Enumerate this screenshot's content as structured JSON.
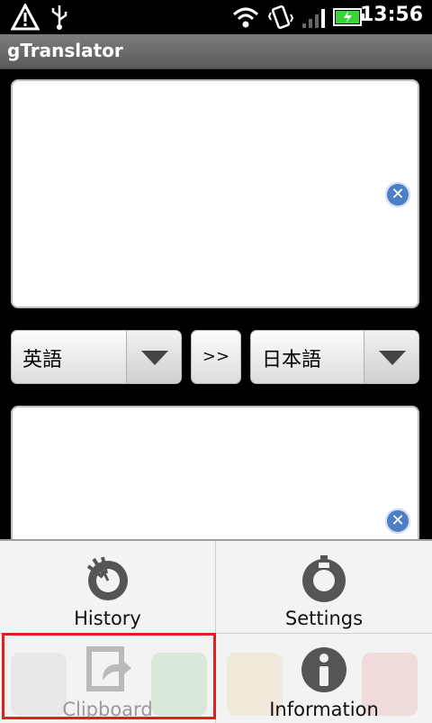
{
  "status_bar": {
    "time": "13:56",
    "icons": [
      "warning-icon",
      "usb-icon",
      "wifi-icon",
      "vibrate-icon",
      "signal-icon",
      "battery-charging-icon"
    ]
  },
  "app": {
    "title": "gTranslator"
  },
  "source_box": {
    "value": ""
  },
  "target_box": {
    "value": ""
  },
  "languages": {
    "from": "英語",
    "swap_label": ">>",
    "to": "日本語"
  },
  "menu": {
    "items": [
      {
        "label": "History",
        "icon": "history-icon"
      },
      {
        "label": "Settings",
        "icon": "settings-icon"
      },
      {
        "label": "Clipboard",
        "icon": "clipboard-icon",
        "disabled": true
      },
      {
        "label": "Information",
        "icon": "information-icon"
      }
    ]
  },
  "colors": {
    "accent_blue": "#4d7fc8",
    "highlight_red": "#e02020"
  }
}
